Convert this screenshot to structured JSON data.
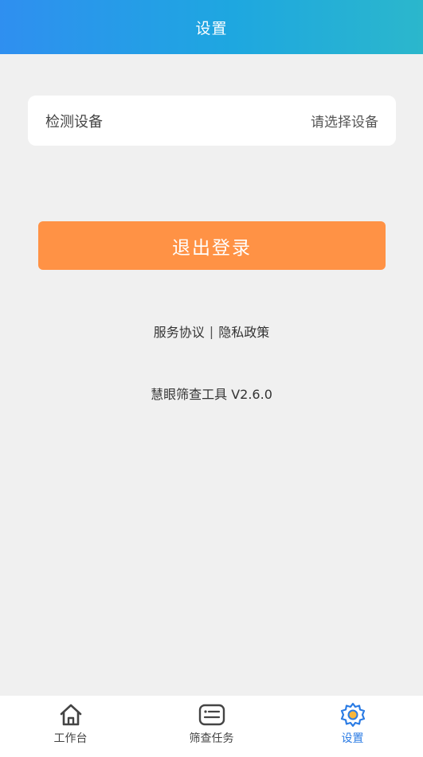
{
  "header": {
    "title": "设置"
  },
  "device": {
    "label": "检测设备",
    "value": "请选择设备"
  },
  "logout": {
    "label": "退出登录"
  },
  "links": {
    "service": "服务协议",
    "separator": "|",
    "privacy": "隐私政策"
  },
  "version": {
    "text": "慧眼筛查工具 V2.6.0"
  },
  "tabbar": {
    "items": [
      {
        "label": "工作台",
        "icon": "home-icon"
      },
      {
        "label": "筛查任务",
        "icon": "task-list-icon"
      },
      {
        "label": "设置",
        "icon": "gear-icon",
        "active": true
      }
    ],
    "active_color": "#2a7be4"
  },
  "colors": {
    "accent": "#ff9245",
    "header_start": "#2f8ff0",
    "header_end": "#2bb7cc"
  }
}
